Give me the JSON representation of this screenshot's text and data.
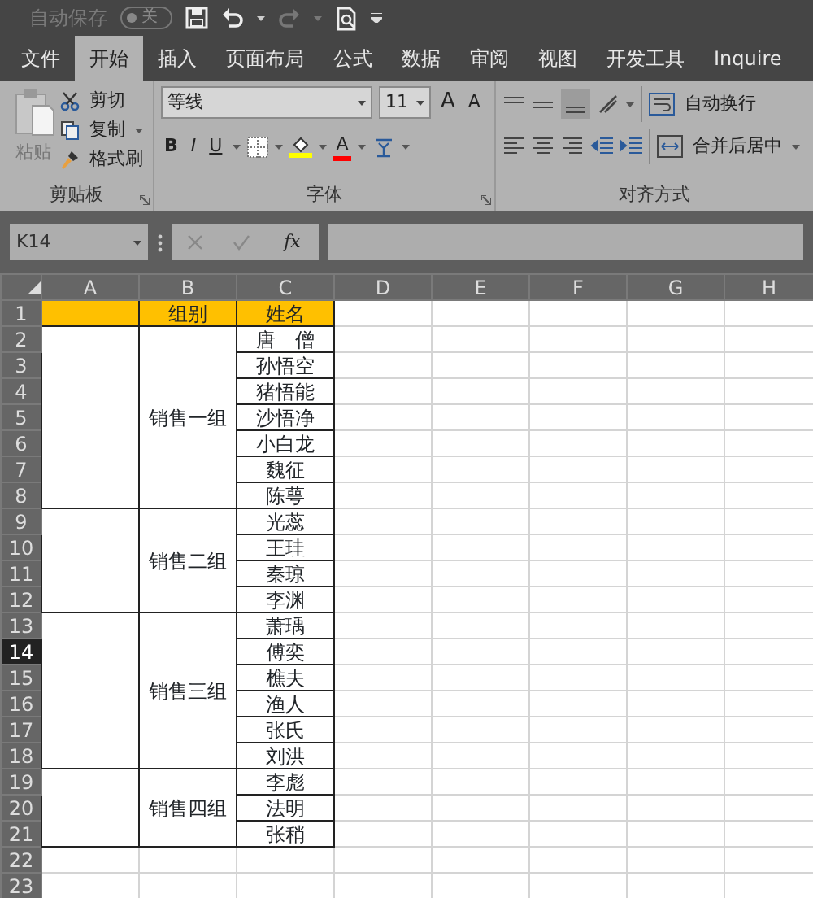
{
  "quick_access": {
    "autosave_label": "自动保存",
    "autosave_on": false,
    "autosave_state": "关",
    "redo_disabled": true
  },
  "tabs": [
    {
      "label": "文件",
      "selected": false
    },
    {
      "label": "开始",
      "selected": true
    },
    {
      "label": "插入",
      "selected": false
    },
    {
      "label": "页面布局",
      "selected": false
    },
    {
      "label": "公式",
      "selected": false
    },
    {
      "label": "数据",
      "selected": false
    },
    {
      "label": "审阅",
      "selected": false
    },
    {
      "label": "视图",
      "selected": false
    },
    {
      "label": "开发工具",
      "selected": false
    },
    {
      "label": "Inquire",
      "selected": false
    }
  ],
  "ribbon": {
    "clipboard": {
      "paste": "粘贴",
      "cut": "剪切",
      "copy": "复制",
      "format_painter": "格式刷",
      "title": "剪贴板"
    },
    "font": {
      "name": "等线",
      "size": "11",
      "grow": "A",
      "shrink": "A",
      "bold": "B",
      "italic": "I",
      "underline": "U",
      "font_color": "A",
      "title": "字体"
    },
    "alignment": {
      "wrap": "自动换行",
      "merge": "合并后居中",
      "title": "对齐方式"
    }
  },
  "formula_bar": {
    "name_box": "K14",
    "fx": "fx"
  },
  "sheet": {
    "columns": [
      "A",
      "B",
      "C",
      "D",
      "E",
      "F",
      "G",
      "H"
    ],
    "rows": [
      {
        "label": "1",
        "selected": false
      },
      {
        "label": "2",
        "selected": false
      },
      {
        "label": "3",
        "selected": false
      },
      {
        "label": "4",
        "selected": false
      },
      {
        "label": "5",
        "selected": false
      },
      {
        "label": "6",
        "selected": false
      },
      {
        "label": "7",
        "selected": false
      },
      {
        "label": "8",
        "selected": false
      },
      {
        "label": "9",
        "selected": false
      },
      {
        "label": "10",
        "selected": false
      },
      {
        "label": "11",
        "selected": false
      },
      {
        "label": "12",
        "selected": false
      },
      {
        "label": "13",
        "selected": false
      },
      {
        "label": "14",
        "selected": true
      },
      {
        "label": "15",
        "selected": false
      },
      {
        "label": "16",
        "selected": false
      },
      {
        "label": "17",
        "selected": false
      },
      {
        "label": "18",
        "selected": false
      },
      {
        "label": "19",
        "selected": false
      },
      {
        "label": "20",
        "selected": false
      },
      {
        "label": "21",
        "selected": false
      },
      {
        "label": "22",
        "selected": false
      },
      {
        "label": "23",
        "selected": false
      }
    ],
    "header": {
      "group": "组别",
      "name": "姓名"
    },
    "groups": [
      {
        "group": "销售一组",
        "members": [
          "唐　僧",
          "孙悟空",
          "猪悟能",
          "沙悟净",
          "小白龙",
          "魏征",
          "陈萼"
        ]
      },
      {
        "group": "销售二组",
        "members": [
          "光蕊",
          "王珪",
          "秦琼",
          "李渊"
        ]
      },
      {
        "group": "销售三组",
        "members": [
          "萧瑀",
          "傅奕",
          "樵夫",
          "渔人",
          "张氏",
          "刘洪"
        ]
      },
      {
        "group": "销售四组",
        "members": [
          "李彪",
          "法明",
          "张稍"
        ]
      }
    ]
  }
}
